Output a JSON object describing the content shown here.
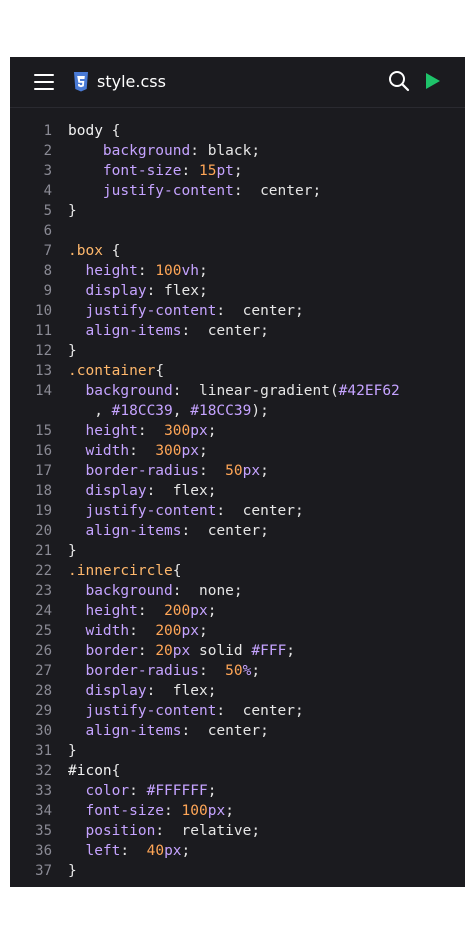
{
  "header": {
    "file_name": "style.css",
    "icons": {
      "menu": "hamburger-menu-icon",
      "file": "css3-file-icon",
      "search": "search-icon",
      "run": "play-run-icon"
    },
    "colors": {
      "background": "#1b1b1f",
      "run": "#1ec36a",
      "file_icon": "#4a7bd6"
    }
  },
  "code": {
    "lines": [
      {
        "n": "1",
        "segs": [
          [
            "sel",
            "body "
          ],
          [
            "pun",
            "{"
          ]
        ]
      },
      {
        "n": "2",
        "segs": [
          [
            "pun",
            "    "
          ],
          [
            "prop",
            "background"
          ],
          [
            "pun",
            ":"
          ],
          [
            "val",
            " black"
          ],
          [
            "pun",
            ";"
          ]
        ]
      },
      {
        "n": "3",
        "segs": [
          [
            "pun",
            "    "
          ],
          [
            "prop",
            "font-size"
          ],
          [
            "pun",
            ": "
          ],
          [
            "num",
            "15"
          ],
          [
            "unit",
            "pt"
          ],
          [
            "pun",
            ";"
          ]
        ]
      },
      {
        "n": "4",
        "segs": [
          [
            "pun",
            "    "
          ],
          [
            "prop",
            "justify-content"
          ],
          [
            "pun",
            ":  "
          ],
          [
            "val",
            "center"
          ],
          [
            "pun",
            ";"
          ]
        ]
      },
      {
        "n": "5",
        "segs": [
          [
            "pun",
            "}"
          ]
        ]
      },
      {
        "n": "6",
        "segs": []
      },
      {
        "n": "7",
        "segs": [
          [
            "cls",
            ".box "
          ],
          [
            "pun",
            "{"
          ]
        ]
      },
      {
        "n": "8",
        "segs": [
          [
            "pun",
            "  "
          ],
          [
            "prop",
            "height"
          ],
          [
            "pun",
            ": "
          ],
          [
            "num",
            "100"
          ],
          [
            "unit",
            "vh"
          ],
          [
            "pun",
            ";"
          ]
        ]
      },
      {
        "n": "9",
        "segs": [
          [
            "pun",
            "  "
          ],
          [
            "prop",
            "display"
          ],
          [
            "pun",
            ": "
          ],
          [
            "val",
            "flex"
          ],
          [
            "pun",
            ";"
          ]
        ]
      },
      {
        "n": "10",
        "segs": [
          [
            "pun",
            "  "
          ],
          [
            "prop",
            "justify-content"
          ],
          [
            "pun",
            ":  "
          ],
          [
            "val",
            "center"
          ],
          [
            "pun",
            ";"
          ]
        ]
      },
      {
        "n": "11",
        "segs": [
          [
            "pun",
            "  "
          ],
          [
            "prop",
            "align-items"
          ],
          [
            "pun",
            ":  "
          ],
          [
            "val",
            "center"
          ],
          [
            "pun",
            ";"
          ]
        ]
      },
      {
        "n": "12",
        "segs": [
          [
            "pun",
            "}"
          ]
        ]
      },
      {
        "n": "13",
        "segs": [
          [
            "cls",
            ".container"
          ],
          [
            "pun",
            "{"
          ]
        ]
      },
      {
        "n": "14",
        "segs": [
          [
            "pun",
            "  "
          ],
          [
            "prop",
            "background"
          ],
          [
            "pun",
            ":  "
          ],
          [
            "val",
            "linear-gradient"
          ],
          [
            "pun",
            "("
          ],
          [
            "hex",
            "#42EF62"
          ]
        ]
      },
      {
        "n": "",
        "segs": [
          [
            "pun",
            "   , "
          ],
          [
            "hex",
            "#18CC39"
          ],
          [
            "pun",
            ", "
          ],
          [
            "hex",
            "#18CC39"
          ],
          [
            "pun",
            ");"
          ]
        ]
      },
      {
        "n": "15",
        "segs": [
          [
            "pun",
            "  "
          ],
          [
            "prop",
            "height"
          ],
          [
            "pun",
            ":  "
          ],
          [
            "num",
            "300"
          ],
          [
            "unit",
            "px"
          ],
          [
            "pun",
            ";"
          ]
        ]
      },
      {
        "n": "16",
        "segs": [
          [
            "pun",
            "  "
          ],
          [
            "prop",
            "width"
          ],
          [
            "pun",
            ":  "
          ],
          [
            "num",
            "300"
          ],
          [
            "unit",
            "px"
          ],
          [
            "pun",
            ";"
          ]
        ]
      },
      {
        "n": "17",
        "segs": [
          [
            "pun",
            "  "
          ],
          [
            "prop",
            "border-radius"
          ],
          [
            "pun",
            ":  "
          ],
          [
            "num",
            "50"
          ],
          [
            "unit",
            "px"
          ],
          [
            "pun",
            ";"
          ]
        ]
      },
      {
        "n": "18",
        "segs": [
          [
            "pun",
            "  "
          ],
          [
            "prop",
            "display"
          ],
          [
            "pun",
            ":  "
          ],
          [
            "val",
            "flex"
          ],
          [
            "pun",
            ";"
          ]
        ]
      },
      {
        "n": "19",
        "segs": [
          [
            "pun",
            "  "
          ],
          [
            "prop",
            "justify-content"
          ],
          [
            "pun",
            ":  "
          ],
          [
            "val",
            "center"
          ],
          [
            "pun",
            ";"
          ]
        ]
      },
      {
        "n": "20",
        "segs": [
          [
            "pun",
            "  "
          ],
          [
            "prop",
            "align-items"
          ],
          [
            "pun",
            ":  "
          ],
          [
            "val",
            "center"
          ],
          [
            "pun",
            ";"
          ]
        ]
      },
      {
        "n": "21",
        "segs": [
          [
            "pun",
            "}"
          ]
        ]
      },
      {
        "n": "22",
        "segs": [
          [
            "cls",
            ".innercircle"
          ],
          [
            "pun",
            "{"
          ]
        ]
      },
      {
        "n": "23",
        "segs": [
          [
            "pun",
            "  "
          ],
          [
            "prop",
            "background"
          ],
          [
            "pun",
            ":  "
          ],
          [
            "val",
            "none"
          ],
          [
            "pun",
            ";"
          ]
        ]
      },
      {
        "n": "24",
        "segs": [
          [
            "pun",
            "  "
          ],
          [
            "prop",
            "height"
          ],
          [
            "pun",
            ":  "
          ],
          [
            "num",
            "200"
          ],
          [
            "unit",
            "px"
          ],
          [
            "pun",
            ";"
          ]
        ]
      },
      {
        "n": "25",
        "segs": [
          [
            "pun",
            "  "
          ],
          [
            "prop",
            "width"
          ],
          [
            "pun",
            ":  "
          ],
          [
            "num",
            "200"
          ],
          [
            "unit",
            "px"
          ],
          [
            "pun",
            ";"
          ]
        ]
      },
      {
        "n": "26",
        "segs": [
          [
            "pun",
            "  "
          ],
          [
            "prop",
            "border"
          ],
          [
            "pun",
            ": "
          ],
          [
            "num",
            "20"
          ],
          [
            "unit",
            "px"
          ],
          [
            "val",
            " solid "
          ],
          [
            "hex",
            "#FFF"
          ],
          [
            "pun",
            ";"
          ]
        ]
      },
      {
        "n": "27",
        "segs": [
          [
            "pun",
            "  "
          ],
          [
            "prop",
            "border-radius"
          ],
          [
            "pun",
            ":  "
          ],
          [
            "num",
            "50"
          ],
          [
            "unit",
            "%"
          ],
          [
            "pun",
            ";"
          ]
        ]
      },
      {
        "n": "28",
        "segs": [
          [
            "pun",
            "  "
          ],
          [
            "prop",
            "display"
          ],
          [
            "pun",
            ":  "
          ],
          [
            "val",
            "flex"
          ],
          [
            "pun",
            ";"
          ]
        ]
      },
      {
        "n": "29",
        "segs": [
          [
            "pun",
            "  "
          ],
          [
            "prop",
            "justify-content"
          ],
          [
            "pun",
            ":  "
          ],
          [
            "val",
            "center"
          ],
          [
            "pun",
            ";"
          ]
        ]
      },
      {
        "n": "30",
        "segs": [
          [
            "pun",
            "  "
          ],
          [
            "prop",
            "align-items"
          ],
          [
            "pun",
            ":  "
          ],
          [
            "val",
            "center"
          ],
          [
            "pun",
            ";"
          ]
        ]
      },
      {
        "n": "31",
        "segs": [
          [
            "pun",
            "}"
          ]
        ]
      },
      {
        "n": "32",
        "segs": [
          [
            "sel",
            "#icon"
          ],
          [
            "pun",
            "{"
          ]
        ]
      },
      {
        "n": "33",
        "segs": [
          [
            "pun",
            "  "
          ],
          [
            "prop",
            "color"
          ],
          [
            "pun",
            ": "
          ],
          [
            "hex",
            "#FFFFFF"
          ],
          [
            "pun",
            ";"
          ]
        ]
      },
      {
        "n": "34",
        "segs": [
          [
            "pun",
            "  "
          ],
          [
            "prop",
            "font-size"
          ],
          [
            "pun",
            ": "
          ],
          [
            "num",
            "100"
          ],
          [
            "unit",
            "px"
          ],
          [
            "pun",
            ";"
          ]
        ]
      },
      {
        "n": "35",
        "segs": [
          [
            "pun",
            "  "
          ],
          [
            "prop",
            "position"
          ],
          [
            "pun",
            ":  "
          ],
          [
            "val",
            "relative"
          ],
          [
            "pun",
            ";"
          ]
        ]
      },
      {
        "n": "36",
        "segs": [
          [
            "pun",
            "  "
          ],
          [
            "prop",
            "left"
          ],
          [
            "pun",
            ":  "
          ],
          [
            "num",
            "40"
          ],
          [
            "unit",
            "px"
          ],
          [
            "pun",
            ";"
          ]
        ]
      },
      {
        "n": "37",
        "segs": [
          [
            "pun",
            "}"
          ]
        ]
      }
    ]
  }
}
